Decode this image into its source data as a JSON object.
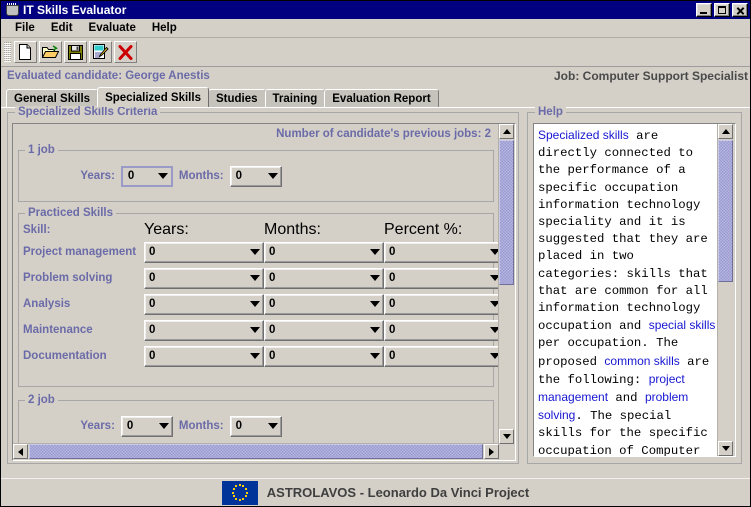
{
  "window": {
    "title": "IT Skills Evaluator",
    "icon": "coffee-cup-icon",
    "controls": {
      "minimize": "minimize-button",
      "maximize": "maximize-button",
      "close": "close-button"
    }
  },
  "menubar": {
    "items": [
      {
        "label": "File"
      },
      {
        "label": "Edit"
      },
      {
        "label": "Evaluate"
      },
      {
        "label": "Help"
      }
    ]
  },
  "toolbar": {
    "buttons": [
      {
        "name": "new-file-button",
        "icon": "new-document-icon"
      },
      {
        "name": "open-file-button",
        "icon": "open-folder-icon"
      },
      {
        "name": "save-button",
        "icon": "floppy-disk-icon"
      },
      {
        "name": "edit-report-button",
        "icon": "notepad-pencil-icon"
      },
      {
        "name": "delete-button",
        "icon": "red-x-icon"
      }
    ]
  },
  "header": {
    "candidate_label": "Evaluated candidate: George Anestis",
    "job_label": "Job: Computer Support Specialist"
  },
  "tabs": [
    {
      "label": "General Skills",
      "active": false
    },
    {
      "label": "Specialized Skills",
      "active": true
    },
    {
      "label": "Studies",
      "active": false
    },
    {
      "label": "Training",
      "active": false
    },
    {
      "label": "Evaluation Report",
      "active": false
    }
  ],
  "criteria": {
    "group_title": "Specialized Skills Criteria",
    "previous_jobs_label": "Number of candidate's previous jobs: 2",
    "job1": {
      "title": "1 job",
      "years_label": "Years:",
      "years_value": "0",
      "months_label": "Months:",
      "months_value": "0"
    },
    "practiced_skills": {
      "title": "Practiced Skills",
      "columns": [
        "Skill:",
        "Years:",
        "Months:",
        "Percent %:"
      ],
      "rows": [
        {
          "skill": "Project management",
          "years": "0",
          "months": "0",
          "percent": "0"
        },
        {
          "skill": "Problem solving",
          "years": "0",
          "months": "0",
          "percent": "0"
        },
        {
          "skill": "Analysis",
          "years": "0",
          "months": "0",
          "percent": "0"
        },
        {
          "skill": "Maintenance",
          "years": "0",
          "months": "0",
          "percent": "0"
        },
        {
          "skill": "Documentation",
          "years": "0",
          "months": "0",
          "percent": "0"
        }
      ]
    },
    "job2": {
      "title": "2 job",
      "years_label": "Years:",
      "years_value": "0",
      "months_label": "Months:",
      "months_value": "0"
    }
  },
  "help": {
    "group_title": "Help",
    "body_html": "<span class=\"lnk\">Specialized skills</span> are directly connected to the performance of a specific occupation information technology speciality and it is suggested that they are placed in two categories: skills that that are common for all information technology occupation and <span class=\"lnk\">special skills</span> per occupation. The proposed <span class=\"lnk\">common skills</span> are the following: <span class=\"lnk\">project management</span> and <span class=\"lnk\">problem solving</span>. The special skills for the specific occupation of Computer"
  },
  "statusbar": {
    "flag": "eu-flag-icon",
    "text": "ASTROLAVOS - Leonardo Da Vinci Project"
  },
  "colors": {
    "titlebar": "#000080",
    "face": "#d4d0c8",
    "label_purple": "#6b6ba8",
    "link_blue": "#1616d2",
    "scroll_thumb": "#9a9ad4",
    "eu_blue": "#003399",
    "eu_star": "#ffcc00"
  }
}
